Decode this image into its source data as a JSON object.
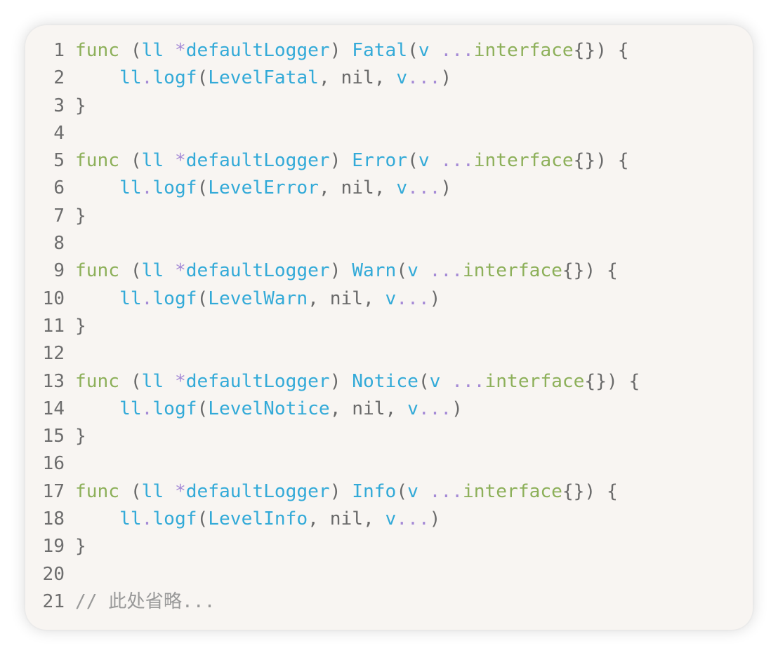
{
  "code": {
    "lines": [
      {
        "number": "1",
        "tokens": [
          [
            "kw",
            "func"
          ],
          [
            "pun",
            " ("
          ],
          [
            "blue",
            "ll"
          ],
          [
            "pun",
            " "
          ],
          [
            "op",
            "*"
          ],
          [
            "blue",
            "defaultLogger"
          ],
          [
            "pun",
            ") "
          ],
          [
            "blue",
            "Fatal"
          ],
          [
            "pun",
            "("
          ],
          [
            "blue",
            "v"
          ],
          [
            "pun",
            " "
          ],
          [
            "op",
            "..."
          ],
          [
            "kw",
            "interface"
          ],
          [
            "pun",
            "{}) {"
          ]
        ]
      },
      {
        "number": "2",
        "tokens": [
          [
            "pun",
            "    "
          ],
          [
            "blue",
            "ll"
          ],
          [
            "op",
            "."
          ],
          [
            "blue",
            "logf"
          ],
          [
            "pun",
            "("
          ],
          [
            "blue",
            "LevelFatal"
          ],
          [
            "pun",
            ", nil, "
          ],
          [
            "blue",
            "v"
          ],
          [
            "op",
            "..."
          ],
          [
            "pun",
            ")"
          ]
        ]
      },
      {
        "number": "3",
        "tokens": [
          [
            "pun",
            "}"
          ]
        ]
      },
      {
        "number": "4",
        "tokens": []
      },
      {
        "number": "5",
        "tokens": [
          [
            "kw",
            "func"
          ],
          [
            "pun",
            " ("
          ],
          [
            "blue",
            "ll"
          ],
          [
            "pun",
            " "
          ],
          [
            "op",
            "*"
          ],
          [
            "blue",
            "defaultLogger"
          ],
          [
            "pun",
            ") "
          ],
          [
            "blue",
            "Error"
          ],
          [
            "pun",
            "("
          ],
          [
            "blue",
            "v"
          ],
          [
            "pun",
            " "
          ],
          [
            "op",
            "..."
          ],
          [
            "kw",
            "interface"
          ],
          [
            "pun",
            "{}) {"
          ]
        ]
      },
      {
        "number": "6",
        "tokens": [
          [
            "pun",
            "    "
          ],
          [
            "blue",
            "ll"
          ],
          [
            "op",
            "."
          ],
          [
            "blue",
            "logf"
          ],
          [
            "pun",
            "("
          ],
          [
            "blue",
            "LevelError"
          ],
          [
            "pun",
            ", nil, "
          ],
          [
            "blue",
            "v"
          ],
          [
            "op",
            "..."
          ],
          [
            "pun",
            ")"
          ]
        ]
      },
      {
        "number": "7",
        "tokens": [
          [
            "pun",
            "}"
          ]
        ]
      },
      {
        "number": "8",
        "tokens": []
      },
      {
        "number": "9",
        "tokens": [
          [
            "kw",
            "func"
          ],
          [
            "pun",
            " ("
          ],
          [
            "blue",
            "ll"
          ],
          [
            "pun",
            " "
          ],
          [
            "op",
            "*"
          ],
          [
            "blue",
            "defaultLogger"
          ],
          [
            "pun",
            ") "
          ],
          [
            "blue",
            "Warn"
          ],
          [
            "pun",
            "("
          ],
          [
            "blue",
            "v"
          ],
          [
            "pun",
            " "
          ],
          [
            "op",
            "..."
          ],
          [
            "kw",
            "interface"
          ],
          [
            "pun",
            "{}) {"
          ]
        ]
      },
      {
        "number": "10",
        "tokens": [
          [
            "pun",
            "    "
          ],
          [
            "blue",
            "ll"
          ],
          [
            "op",
            "."
          ],
          [
            "blue",
            "logf"
          ],
          [
            "pun",
            "("
          ],
          [
            "blue",
            "LevelWarn"
          ],
          [
            "pun",
            ", nil, "
          ],
          [
            "blue",
            "v"
          ],
          [
            "op",
            "..."
          ],
          [
            "pun",
            ")"
          ]
        ]
      },
      {
        "number": "11",
        "tokens": [
          [
            "pun",
            "}"
          ]
        ]
      },
      {
        "number": "12",
        "tokens": []
      },
      {
        "number": "13",
        "tokens": [
          [
            "kw",
            "func"
          ],
          [
            "pun",
            " ("
          ],
          [
            "blue",
            "ll"
          ],
          [
            "pun",
            " "
          ],
          [
            "op",
            "*"
          ],
          [
            "blue",
            "defaultLogger"
          ],
          [
            "pun",
            ") "
          ],
          [
            "blue",
            "Notice"
          ],
          [
            "pun",
            "("
          ],
          [
            "blue",
            "v"
          ],
          [
            "pun",
            " "
          ],
          [
            "op",
            "..."
          ],
          [
            "kw",
            "interface"
          ],
          [
            "pun",
            "{}) {"
          ]
        ]
      },
      {
        "number": "14",
        "tokens": [
          [
            "pun",
            "    "
          ],
          [
            "blue",
            "ll"
          ],
          [
            "op",
            "."
          ],
          [
            "blue",
            "logf"
          ],
          [
            "pun",
            "("
          ],
          [
            "blue",
            "LevelNotice"
          ],
          [
            "pun",
            ", nil, "
          ],
          [
            "blue",
            "v"
          ],
          [
            "op",
            "..."
          ],
          [
            "pun",
            ")"
          ]
        ]
      },
      {
        "number": "15",
        "tokens": [
          [
            "pun",
            "}"
          ]
        ]
      },
      {
        "number": "16",
        "tokens": []
      },
      {
        "number": "17",
        "tokens": [
          [
            "kw",
            "func"
          ],
          [
            "pun",
            " ("
          ],
          [
            "blue",
            "ll"
          ],
          [
            "pun",
            " "
          ],
          [
            "op",
            "*"
          ],
          [
            "blue",
            "defaultLogger"
          ],
          [
            "pun",
            ") "
          ],
          [
            "blue",
            "Info"
          ],
          [
            "pun",
            "("
          ],
          [
            "blue",
            "v"
          ],
          [
            "pun",
            " "
          ],
          [
            "op",
            "..."
          ],
          [
            "kw",
            "interface"
          ],
          [
            "pun",
            "{}) {"
          ]
        ]
      },
      {
        "number": "18",
        "tokens": [
          [
            "pun",
            "    "
          ],
          [
            "blue",
            "ll"
          ],
          [
            "op",
            "."
          ],
          [
            "blue",
            "logf"
          ],
          [
            "pun",
            "("
          ],
          [
            "blue",
            "LevelInfo"
          ],
          [
            "pun",
            ", nil, "
          ],
          [
            "blue",
            "v"
          ],
          [
            "op",
            "..."
          ],
          [
            "pun",
            ")"
          ]
        ]
      },
      {
        "number": "19",
        "tokens": [
          [
            "pun",
            "}"
          ]
        ]
      },
      {
        "number": "20",
        "tokens": []
      },
      {
        "number": "21",
        "tokens": [
          [
            "cm",
            "// 此处省略..."
          ]
        ]
      }
    ]
  },
  "colors": {
    "background": "#f8f5f2",
    "keyword": "#8db05a",
    "identifier": "#33aad8",
    "punctuation": "#6a6a6a",
    "operator": "#a58ad6",
    "comment": "#999999",
    "line_number": "#6e6e6e"
  }
}
